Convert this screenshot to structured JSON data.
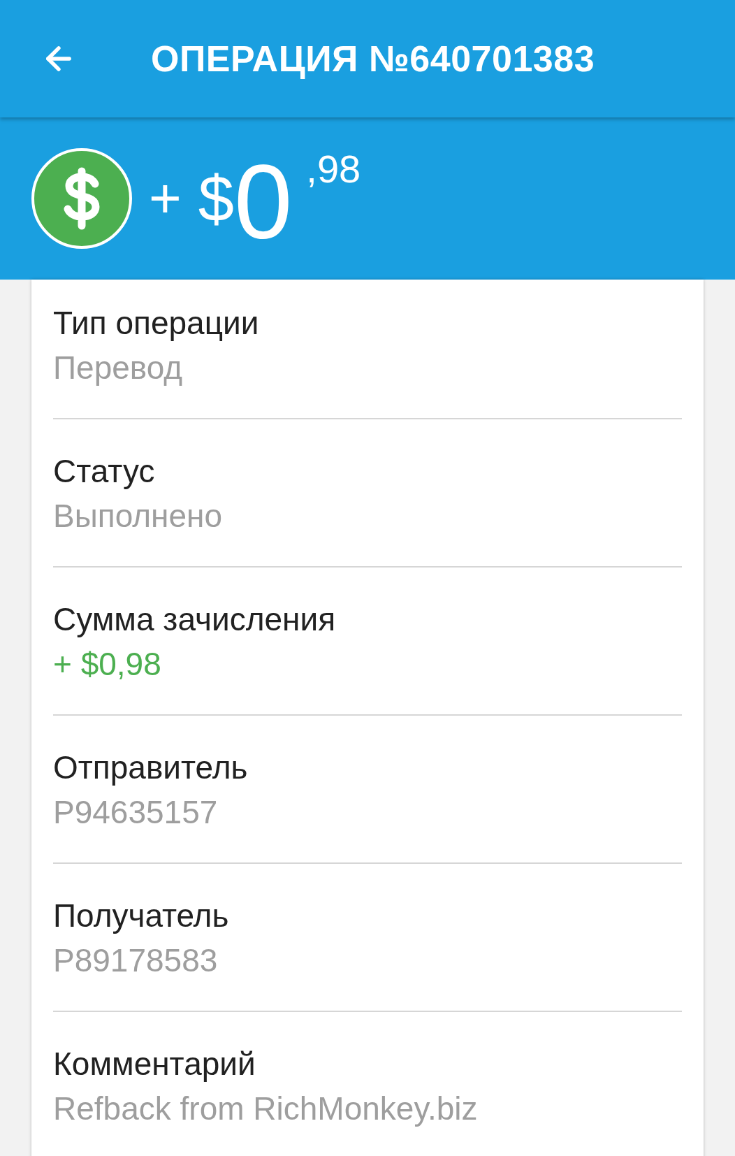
{
  "header": {
    "title": "ОПЕРАЦИЯ №640701383"
  },
  "amount": {
    "sign": "+",
    "currency": "$",
    "integer": "0",
    "fraction": ",98"
  },
  "fields": [
    {
      "label": "Тип операции",
      "value": "Перевод",
      "kind": "plain"
    },
    {
      "label": "Статус",
      "value": "Выполнено",
      "kind": "plain"
    },
    {
      "label": "Сумма зачисления",
      "value": "+ $0,98",
      "kind": "credit"
    },
    {
      "label": "Отправитель",
      "value": "P94635157",
      "kind": "plain"
    },
    {
      "label": "Получатель",
      "value": "P89178583",
      "kind": "plain"
    },
    {
      "label": "Комментарий",
      "value": "Refback from RichMonkey.biz",
      "kind": "plain"
    }
  ]
}
